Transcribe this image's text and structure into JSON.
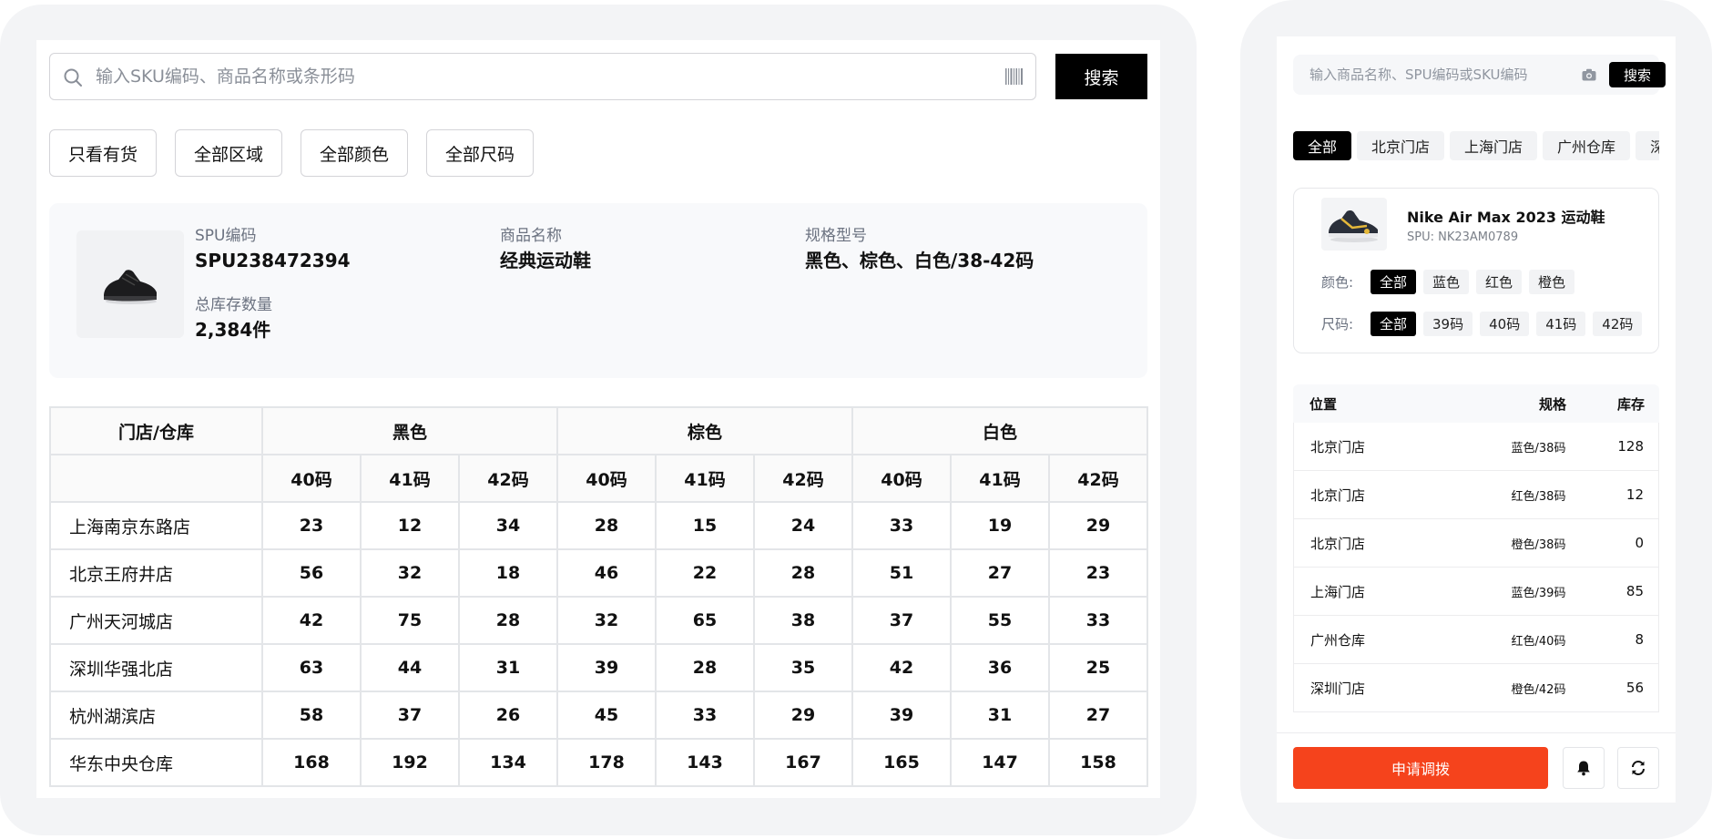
{
  "desktop": {
    "search": {
      "placeholder": "输入SKU编码、商品名称或条形码",
      "button_label": "搜索"
    },
    "filters": [
      {
        "label": "只看有货"
      },
      {
        "label": "全部区域"
      },
      {
        "label": "全部颜色"
      },
      {
        "label": "全部尺码"
      }
    ],
    "product": {
      "spu_label": "SPU编码",
      "spu_value": "SPU238472394",
      "name_label": "商品名称",
      "name_value": "经典运动鞋",
      "spec_label": "规格型号",
      "spec_value": "黑色、棕色、白色/38-42码",
      "total_label": "总库存数量",
      "total_value": "2,384件"
    },
    "table": {
      "location_header": "门店/仓库",
      "colors": [
        "黑色",
        "棕色",
        "白色"
      ],
      "sizes": [
        "40码",
        "41码",
        "42码"
      ],
      "rows": [
        {
          "location": "上海南京东路店",
          "values": [
            "23",
            "12",
            "34",
            "28",
            "15",
            "24",
            "33",
            "19",
            "29"
          ]
        },
        {
          "location": "北京王府井店",
          "values": [
            "56",
            "32",
            "18",
            "46",
            "22",
            "28",
            "51",
            "27",
            "23"
          ]
        },
        {
          "location": "广州天河城店",
          "values": [
            "42",
            "75",
            "28",
            "32",
            "65",
            "38",
            "37",
            "55",
            "33"
          ]
        },
        {
          "location": "深圳华强北店",
          "values": [
            "63",
            "44",
            "31",
            "39",
            "28",
            "35",
            "42",
            "36",
            "25"
          ]
        },
        {
          "location": "杭州湖滨店",
          "values": [
            "58",
            "37",
            "26",
            "45",
            "33",
            "29",
            "39",
            "31",
            "27"
          ]
        },
        {
          "location": "华东中央仓库",
          "values": [
            "168",
            "192",
            "134",
            "178",
            "143",
            "167",
            "165",
            "147",
            "158"
          ]
        }
      ]
    }
  },
  "mobile": {
    "search": {
      "placeholder": "输入商品名称、SPU编码或SKU编码",
      "button_label": "搜索"
    },
    "tabs": [
      {
        "label": "全部",
        "active": true
      },
      {
        "label": "北京门店",
        "active": false
      },
      {
        "label": "上海门店",
        "active": false
      },
      {
        "label": "广州仓库",
        "active": false
      },
      {
        "label": "深圳门店",
        "active": false
      }
    ],
    "product": {
      "title": "Nike Air Max 2023 运动鞋",
      "spu": "SPU: NK23AM0789",
      "color_label": "颜色:",
      "colors": [
        {
          "label": "全部",
          "active": true
        },
        {
          "label": "蓝色",
          "active": false
        },
        {
          "label": "红色",
          "active": false
        },
        {
          "label": "橙色",
          "active": false
        }
      ],
      "size_label": "尺码:",
      "sizes": [
        {
          "label": "全部",
          "active": true
        },
        {
          "label": "39码",
          "active": false
        },
        {
          "label": "40码",
          "active": false
        },
        {
          "label": "41码",
          "active": false
        },
        {
          "label": "42码",
          "active": false
        }
      ]
    },
    "list": {
      "headers": {
        "location": "位置",
        "spec": "规格",
        "qty": "库存"
      },
      "rows": [
        {
          "location": "北京门店",
          "spec": "蓝色/38码",
          "qty": "128"
        },
        {
          "location": "北京门店",
          "spec": "红色/38码",
          "qty": "12"
        },
        {
          "location": "北京门店",
          "spec": "橙色/38码",
          "qty": "0"
        },
        {
          "location": "上海门店",
          "spec": "蓝色/39码",
          "qty": "85"
        },
        {
          "location": "广州仓库",
          "spec": "红色/40码",
          "qty": "8"
        },
        {
          "location": "深圳门店",
          "spec": "橙色/42码",
          "qty": "56"
        }
      ]
    },
    "footer": {
      "apply_label": "申请调拨",
      "bell_icon": "bell-icon",
      "refresh_icon": "refresh-icon"
    }
  },
  "colors": {
    "primary": "#000000",
    "accent": "#f5431c",
    "frame": "#f3f4f6",
    "border": "#d4d4d8"
  }
}
